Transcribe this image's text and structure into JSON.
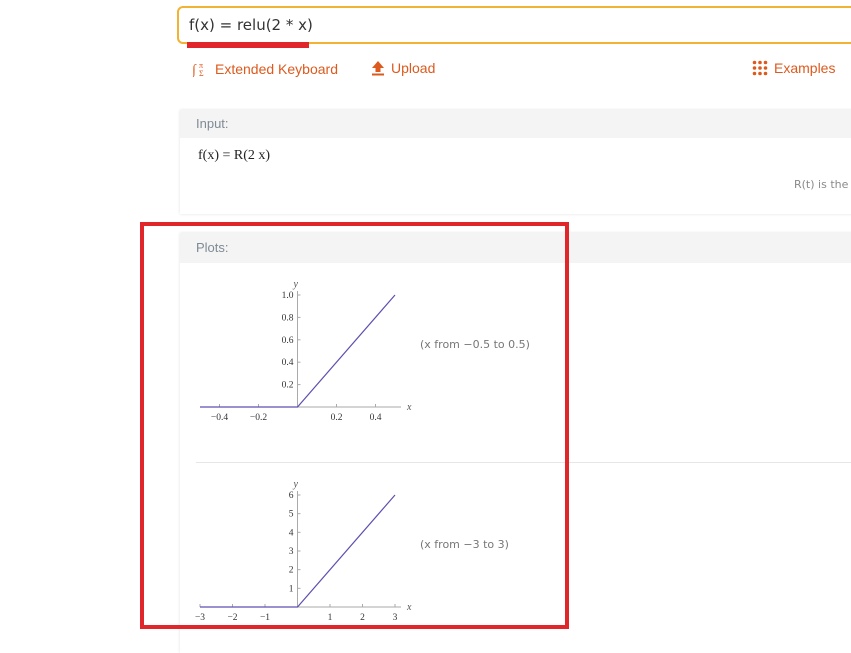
{
  "search": {
    "value": "f(x) = relu(2 * x)"
  },
  "toolbar": {
    "extended_keyboard_label": "Extended Keyboard",
    "upload_label": "Upload",
    "examples_label": "Examples"
  },
  "input_pod": {
    "header": "Input:",
    "formula": "f(x) = R(2 x)",
    "note": "R(t) is the"
  },
  "plots_pod": {
    "header": "Plots:",
    "plot1_range": "(x from −0.5 to 0.5)",
    "plot2_range": "(x from −3 to 3)"
  },
  "colors": {
    "accent": "#dd5a1e",
    "highlight": "#e0262b",
    "search_border": "#f2b233",
    "plot_line": "#5f4fb0"
  },
  "chart_data": [
    {
      "type": "line",
      "x": [
        -0.5,
        0,
        0.5
      ],
      "y": [
        0,
        0,
        1.0
      ],
      "xlabel": "x",
      "ylabel": "y",
      "xlim": [
        -0.5,
        0.5
      ],
      "ylim": [
        0,
        1.0
      ],
      "xticks": [
        "−0.4",
        "−0.2",
        "0.2",
        "0.4"
      ],
      "xtick_values": [
        -0.4,
        -0.2,
        0.2,
        0.4
      ],
      "yticks": [
        "0.2",
        "0.4",
        "0.6",
        "0.8",
        "1.0"
      ],
      "ytick_values": [
        0.2,
        0.4,
        0.6,
        0.8,
        1.0
      ]
    },
    {
      "type": "line",
      "x": [
        -3,
        0,
        3
      ],
      "y": [
        0,
        0,
        6
      ],
      "xlabel": "x",
      "ylabel": "y",
      "xlim": [
        -3,
        3
      ],
      "ylim": [
        0,
        6
      ],
      "xticks": [
        "−3",
        "−2",
        "−1",
        "1",
        "2",
        "3"
      ],
      "xtick_values": [
        -3,
        -2,
        -1,
        1,
        2,
        3
      ],
      "yticks": [
        "1",
        "2",
        "3",
        "4",
        "5",
        "6"
      ],
      "ytick_values": [
        1,
        2,
        3,
        4,
        5,
        6
      ]
    }
  ]
}
